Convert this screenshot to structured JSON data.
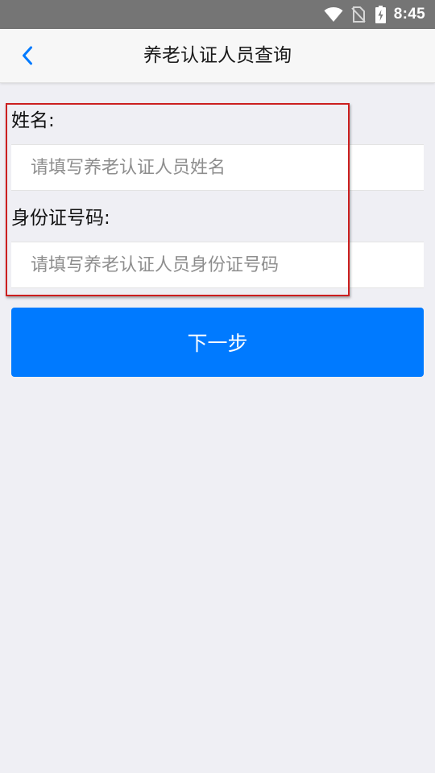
{
  "status_bar": {
    "time": "8:45",
    "icons": [
      "wifi-icon",
      "no-sim-icon",
      "battery-charging-icon"
    ]
  },
  "nav": {
    "title": "养老认证人员查询",
    "back_icon": "chevron-left-icon"
  },
  "form": {
    "name": {
      "label": "姓名:",
      "value": "",
      "placeholder": "请填写养老认证人员姓名"
    },
    "id_number": {
      "label": "身份证号码:",
      "value": "",
      "placeholder": "请填写养老认证人员身份证号码"
    }
  },
  "next_button": {
    "label": "下一步"
  },
  "colors": {
    "accent": "#007aff",
    "background": "#efeff4",
    "status_bar": "#757575",
    "annotation_box": "#cc1f1f"
  }
}
